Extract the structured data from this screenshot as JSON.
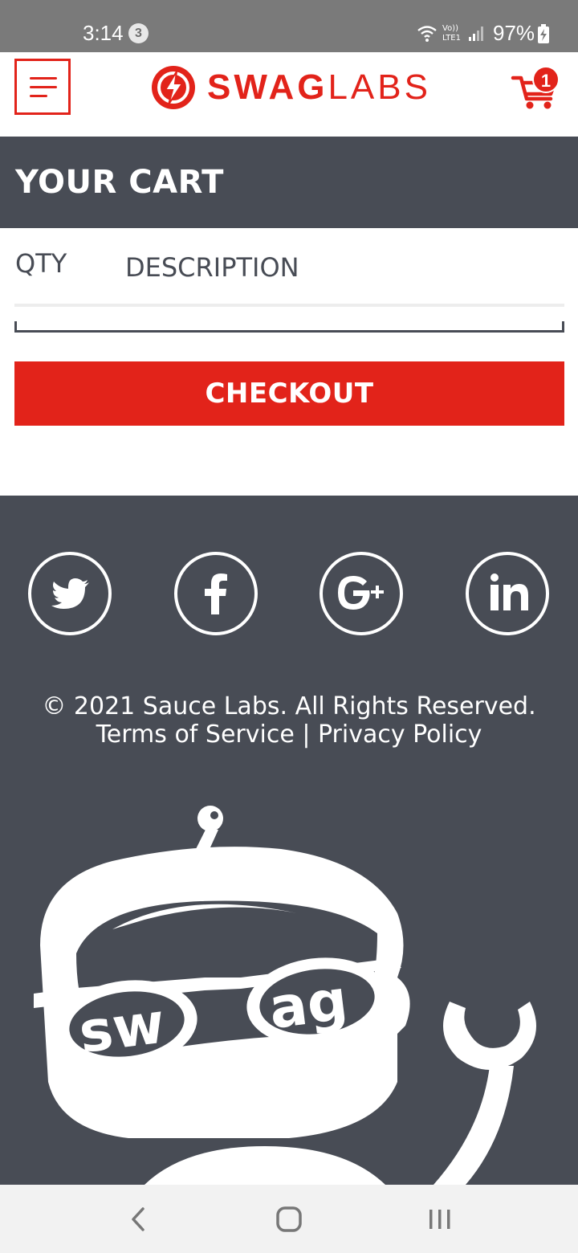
{
  "status_bar": {
    "time": "3:14",
    "notification_count": "3",
    "network_label": "Vo)) LTE1",
    "battery": "97%"
  },
  "header": {
    "brand_bold": "SWAG",
    "brand_light": "LABS",
    "cart_count": "1",
    "brand_color": "#e2231a"
  },
  "page": {
    "title": "YOUR CART",
    "columns": {
      "qty": "QTY",
      "description": "DESCRIPTION"
    },
    "items": [],
    "checkout_label": "CHECKOUT"
  },
  "footer": {
    "social": [
      {
        "name": "twitter",
        "icon": "twitter-icon"
      },
      {
        "name": "facebook",
        "icon": "facebook-icon"
      },
      {
        "name": "google-plus",
        "icon": "google-plus-icon"
      },
      {
        "name": "linkedin",
        "icon": "linkedin-icon"
      }
    ],
    "copyright": "© 2021 Sauce Labs. All Rights Reserved.",
    "terms": "Terms of Service",
    "separator": "|",
    "privacy": "Privacy Policy",
    "mascot_text": "swag",
    "background_color": "#484c55"
  },
  "nav_bar": {
    "buttons": [
      "back-icon",
      "home-icon",
      "recents-icon"
    ]
  }
}
